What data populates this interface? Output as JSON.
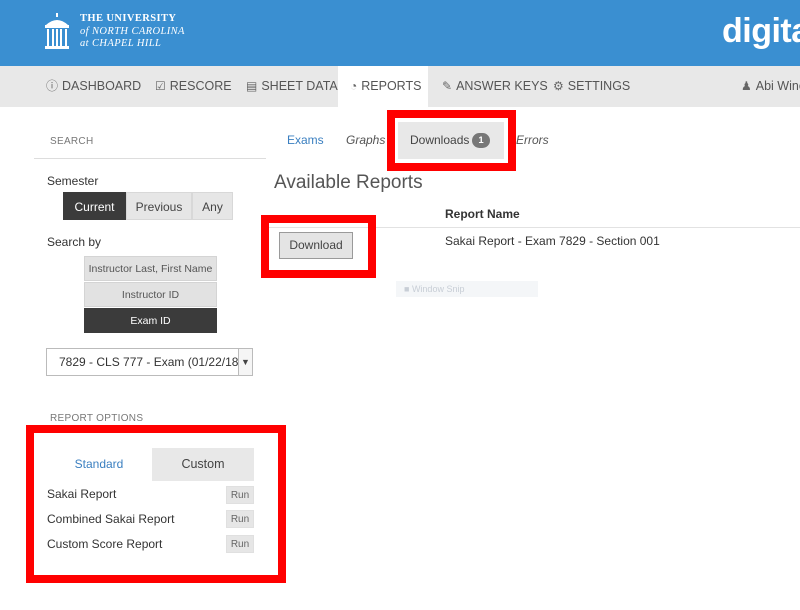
{
  "header": {
    "university_line1": "THE UNIVERSITY",
    "university_line2": "of NORTH CAROLINA",
    "university_line3": "at CHAPEL HILL",
    "brand": "digital",
    "colors": {
      "header_bg": "#3a8fd1",
      "highlight": "#ff0000"
    }
  },
  "nav": {
    "items": [
      {
        "label": "DASHBOARD",
        "icon": "info-circle-icon"
      },
      {
        "label": "RESCORE",
        "icon": "check-square-icon"
      },
      {
        "label": "SHEET DATA",
        "icon": "document-icon"
      },
      {
        "label": "REPORTS",
        "icon": "pie-chart-icon",
        "active": true
      },
      {
        "label": "ANSWER KEYS",
        "icon": "pencil-icon"
      },
      {
        "label": "SETTINGS",
        "icon": "gear-icon"
      }
    ],
    "user": "Abi Wine"
  },
  "sidebar": {
    "search_heading": "SEARCH",
    "semester_label": "Semester",
    "semester_options": [
      "Current",
      "Previous",
      "Any"
    ],
    "semester_selected": "Current",
    "search_by_label": "Search by",
    "search_by_options": [
      "Instructor Last, First Name",
      "Instructor ID",
      "Exam ID"
    ],
    "search_by_selected": "Exam ID",
    "exam_select_value": "7829 - CLS 777 - Exam (01/22/18",
    "report_options_heading": "REPORT OPTIONS",
    "report_tabs": [
      "Standard",
      "Custom"
    ],
    "reports": [
      {
        "name": "Sakai Report",
        "action": "Run"
      },
      {
        "name": "Combined Sakai Report",
        "action": "Run"
      },
      {
        "name": "Custom Score Report",
        "action": "Run"
      }
    ]
  },
  "main": {
    "tabs": {
      "exams": "Exams",
      "graphs": "Graphs",
      "downloads": "Downloads",
      "downloads_count": "1",
      "errors": "Errors"
    },
    "title": "Available Reports",
    "column_header": "Report Name",
    "download_button": "Download",
    "report_name": "Sakai Report - Exam 7829 - Section 001",
    "ghost_text": "Window Snip"
  }
}
